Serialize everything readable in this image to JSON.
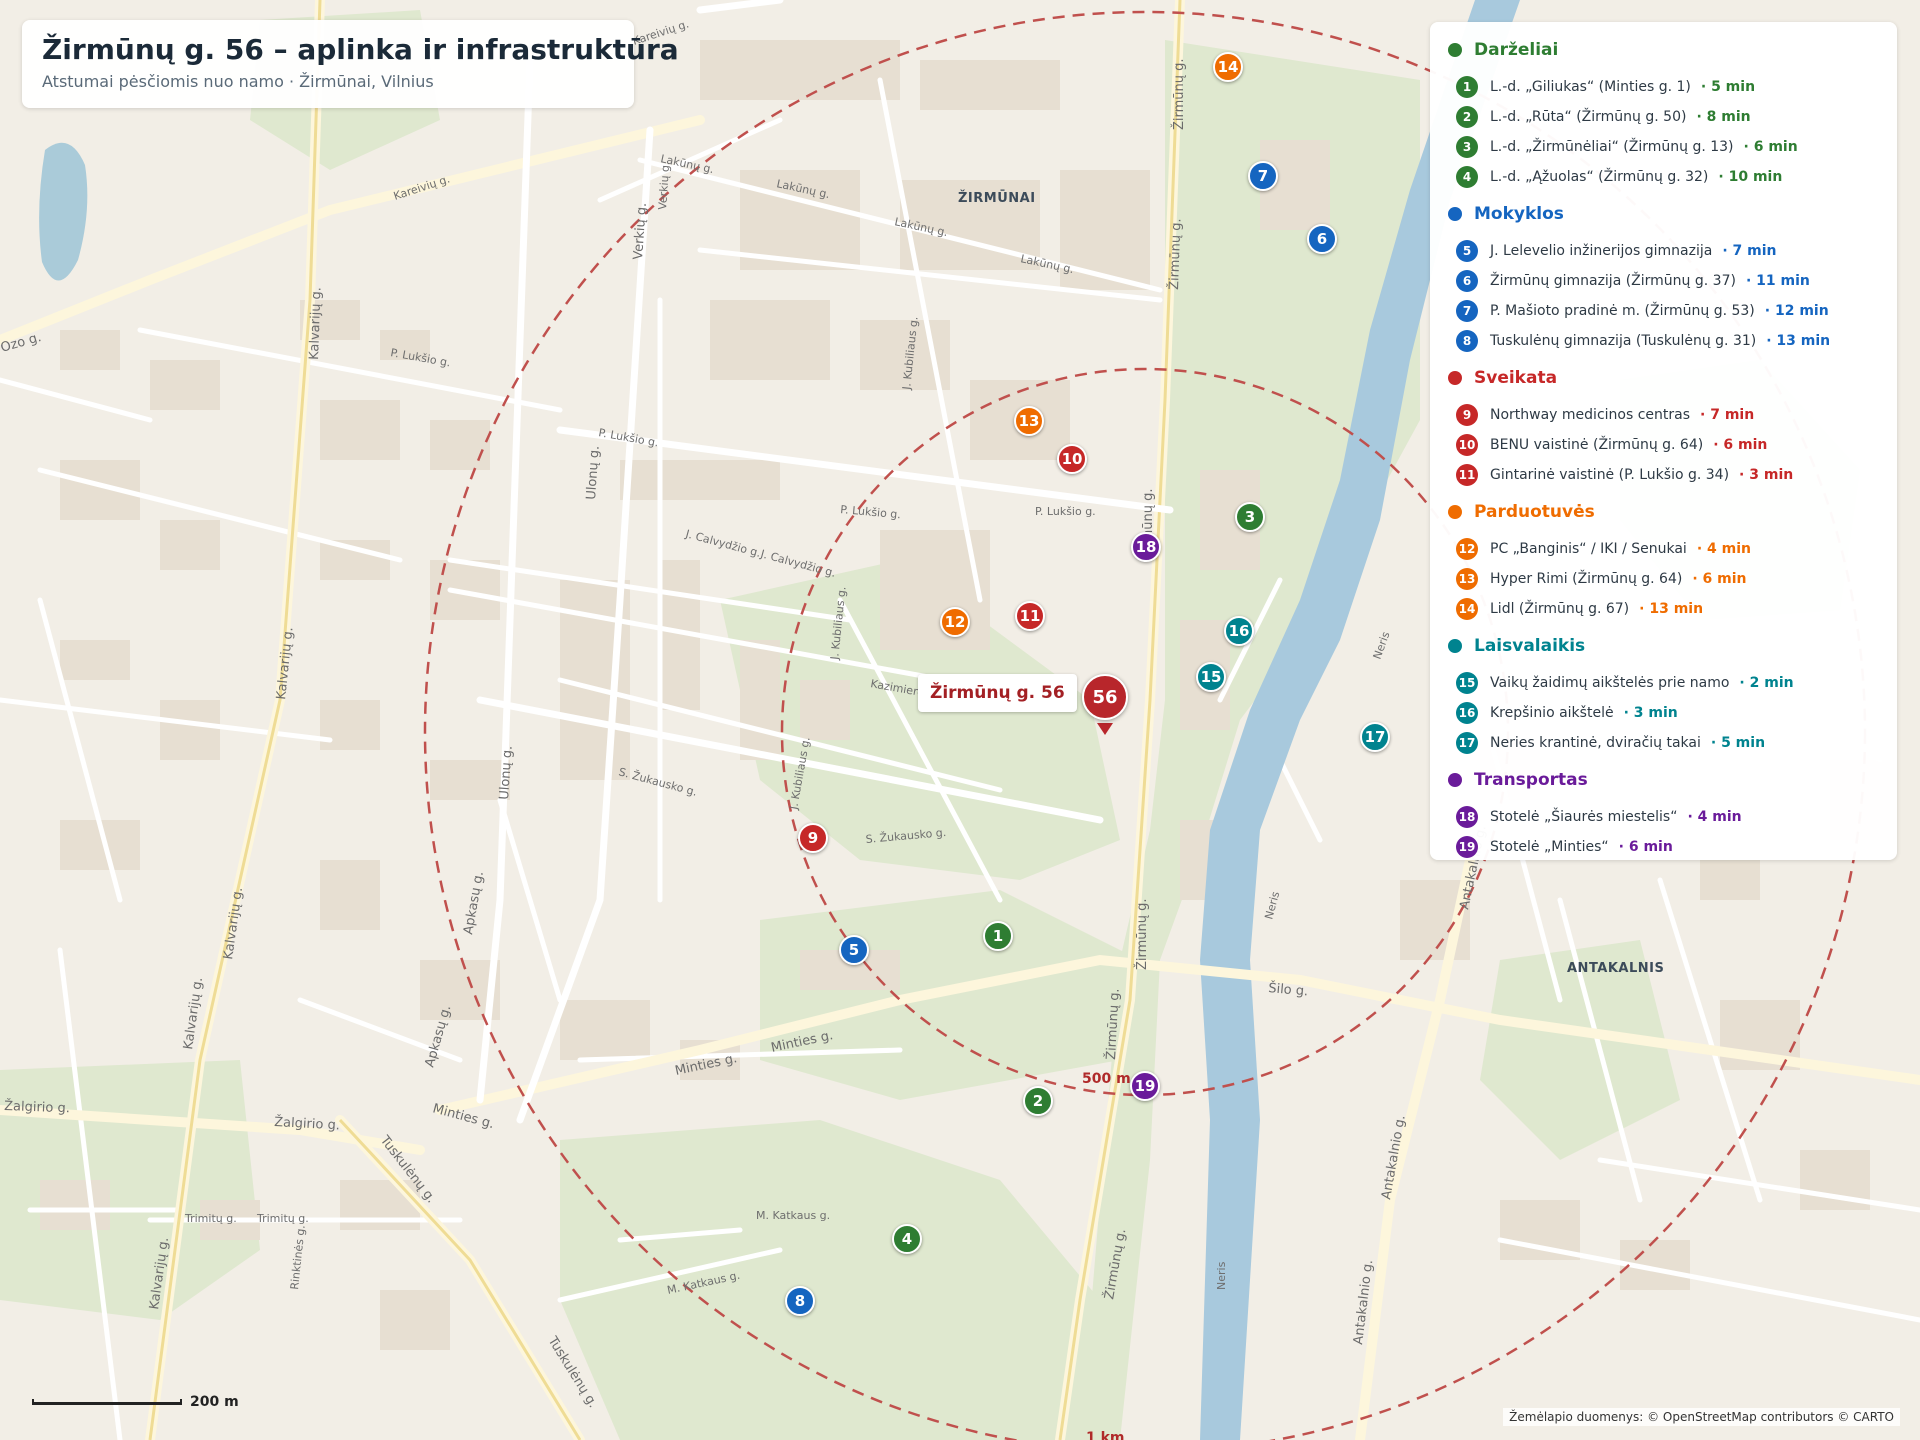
{
  "header": {
    "title": "Žirmūnų g. 56 – aplinka ir infrastruktūra",
    "subtitle": "Atstumai pėsčiomis nuo namo  ·  Žirmūnai, Vilnius"
  },
  "home": {
    "label": "Žirmūnų g. 56",
    "marker": "56",
    "color": "#b8262b"
  },
  "rings": [
    "500 m",
    "1 km"
  ],
  "scale": {
    "label": "200 m"
  },
  "attribution": "Žemėlapio duomenys: © OpenStreetMap contributors © CARTO",
  "areas": [
    "ŽIRMŪNAI",
    "ANTAKALNIS"
  ],
  "river": "Neris",
  "streets": {
    "zirmunu": "Žirmūnų g.",
    "kalvariju": "Kalvarijų g.",
    "ulonu": "Ulonų g.",
    "verkiu": "Verkių g.",
    "luksio": "P. Lukšio g.",
    "kareiviu": "Kareivių g.",
    "minties": "Minties g.",
    "silo": "Šilo g.",
    "zalgirio": "Žalgirio g.",
    "tuskulenu": "Tuskulėnų g.",
    "lakunu": "Lakūnų g.",
    "kubiliaus": "J. Kubiliaus g.",
    "zukausko": "S. Žukausko g.",
    "apkasu": "Apkasų g.",
    "antakalnio": "Antakalnio g.",
    "ozo": "Ozo g.",
    "mkatkaus": "M. Katkaus g.",
    "calvydzio": "J. Calvydžio g.",
    "kazimiero": "Kazimiero L",
    "trimitu": "Trimitų g.",
    "rinktines": "Rinktinės g."
  },
  "legend": {
    "categories": [
      {
        "id": "darzeliai",
        "label": "Darželiai",
        "color": "#2e7d32",
        "items": [
          {
            "num": "1",
            "name": "L.-d. „Giliukas“ (Minties g. 1)",
            "time": "· 5 min"
          },
          {
            "num": "2",
            "name": "L.-d. „Rūta“ (Žirmūnų g. 50)",
            "time": "· 8 min"
          },
          {
            "num": "3",
            "name": "L.-d. „Žirmūnėliai“ (Žirmūnų g. 13)",
            "time": "· 6 min"
          },
          {
            "num": "4",
            "name": "L.-d. „Ąžuolas“ (Žirmūnų g. 32)",
            "time": "· 10 min"
          }
        ]
      },
      {
        "id": "mokyklos",
        "label": "Mokyklos",
        "color": "#1565c0",
        "items": [
          {
            "num": "5",
            "name": "J. Lelevelio inžinerijos gimnazija",
            "time": "· 7 min"
          },
          {
            "num": "6",
            "name": "Žirmūnų gimnazija (Žirmūnų g. 37)",
            "time": "· 11 min"
          },
          {
            "num": "7",
            "name": "P. Mašioto pradinė m. (Žirmūnų g. 53)",
            "time": "· 12 min"
          },
          {
            "num": "8",
            "name": "Tuskulėnų gimnazija (Tuskulėnų g. 31)",
            "time": "· 13 min"
          }
        ]
      },
      {
        "id": "sveikata",
        "label": "Sveikata",
        "color": "#c62828",
        "items": [
          {
            "num": "9",
            "name": "Northway medicinos centras",
            "time": "· 7 min"
          },
          {
            "num": "10",
            "name": "BENU vaistinė (Žirmūnų g. 64)",
            "time": "· 6 min"
          },
          {
            "num": "11",
            "name": "Gintarinė vaistinė (P. Lukšio g. 34)",
            "time": "· 3 min"
          }
        ]
      },
      {
        "id": "parduotuves",
        "label": "Parduotuvės",
        "color": "#ef6c00",
        "items": [
          {
            "num": "12",
            "name": "PC „Banginis“ / IKI / Senukai",
            "time": "· 4 min"
          },
          {
            "num": "13",
            "name": "Hyper Rimi (Žirmūnų g. 64)",
            "time": "· 6 min"
          },
          {
            "num": "14",
            "name": "Lidl (Žirmūnų g. 67)",
            "time": "· 13 min"
          }
        ]
      },
      {
        "id": "laisvalaikis",
        "label": "Laisvalaikis",
        "color": "#00838f",
        "items": [
          {
            "num": "15",
            "name": "Vaikų žaidimų aikštelės prie namo",
            "time": "· 2 min"
          },
          {
            "num": "16",
            "name": "Krepšinio aikštelė",
            "time": "· 3 min"
          },
          {
            "num": "17",
            "name": "Neries krantinė, dviračių takai",
            "time": "· 5 min"
          }
        ]
      },
      {
        "id": "transportas",
        "label": "Transportas",
        "color": "#6a1b9a",
        "items": [
          {
            "num": "18",
            "name": "Stotelė „Šiaurės miestelis“",
            "time": "· 4 min"
          },
          {
            "num": "19",
            "name": "Stotelė „Minties“",
            "time": "· 6 min"
          }
        ]
      }
    ]
  }
}
